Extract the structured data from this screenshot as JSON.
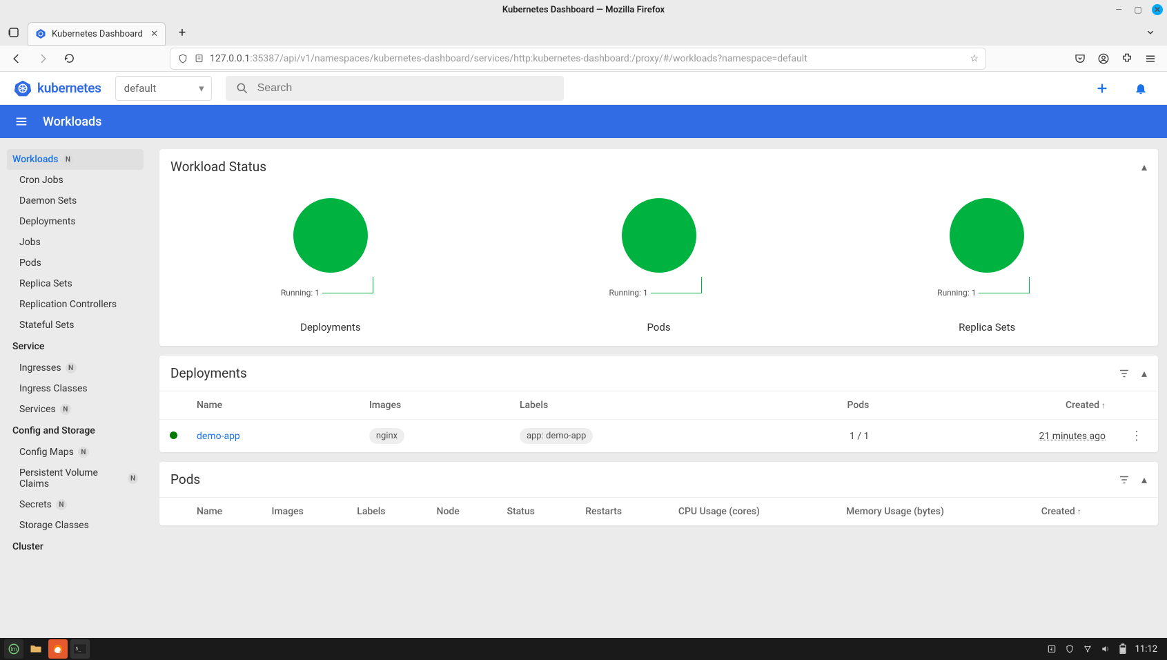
{
  "os": {
    "title": "Kubernetes Dashboard — Mozilla Firefox",
    "clock": "11:12"
  },
  "browser": {
    "tab_title": "Kubernetes Dashboard",
    "url_host": "127.0.0.1",
    "url_port": ":35387",
    "url_path": "/api/v1/namespaces/kubernetes-dashboard/services/http:kubernetes-dashboard:/proxy/#/workloads?namespace=default"
  },
  "header": {
    "logo_text": "kubernetes",
    "namespace": "default",
    "search_placeholder": "Search"
  },
  "bluebar": {
    "title": "Workloads"
  },
  "sidebar": {
    "workloads": {
      "label": "Workloads",
      "badge": "N",
      "items": [
        {
          "label": "Cron Jobs"
        },
        {
          "label": "Daemon Sets"
        },
        {
          "label": "Deployments"
        },
        {
          "label": "Jobs"
        },
        {
          "label": "Pods"
        },
        {
          "label": "Replica Sets"
        },
        {
          "label": "Replication Controllers"
        },
        {
          "label": "Stateful Sets"
        }
      ]
    },
    "service": {
      "label": "Service",
      "items": [
        {
          "label": "Ingresses",
          "badge": "N"
        },
        {
          "label": "Ingress Classes"
        },
        {
          "label": "Services",
          "badge": "N"
        }
      ]
    },
    "config": {
      "label": "Config and Storage",
      "items": [
        {
          "label": "Config Maps",
          "badge": "N"
        },
        {
          "label": "Persistent Volume Claims",
          "badge": "N"
        },
        {
          "label": "Secrets",
          "badge": "N"
        },
        {
          "label": "Storage Classes"
        }
      ]
    },
    "cluster": {
      "label": "Cluster"
    }
  },
  "cards": {
    "workload_status": {
      "title": "Workload Status",
      "charts": [
        {
          "title": "Deployments",
          "legend": "Running: 1"
        },
        {
          "title": "Pods",
          "legend": "Running: 1"
        },
        {
          "title": "Replica Sets",
          "legend": "Running: 1"
        }
      ]
    },
    "deployments": {
      "title": "Deployments",
      "headers": {
        "name": "Name",
        "images": "Images",
        "labels": "Labels",
        "pods": "Pods",
        "created": "Created"
      },
      "rows": [
        {
          "name": "demo-app",
          "image": "nginx",
          "label": "app: demo-app",
          "pods": "1 / 1",
          "created": "21 minutes ago"
        }
      ]
    },
    "pods": {
      "title": "Pods",
      "headers": {
        "name": "Name",
        "images": "Images",
        "labels": "Labels",
        "node": "Node",
        "status": "Status",
        "restarts": "Restarts",
        "cpu": "CPU Usage (cores)",
        "mem": "Memory Usage (bytes)",
        "created": "Created"
      }
    }
  },
  "chart_data": [
    {
      "type": "pie",
      "title": "Deployments",
      "slices": [
        {
          "name": "Running",
          "value": 1,
          "color": "#00b341"
        }
      ]
    },
    {
      "type": "pie",
      "title": "Pods",
      "slices": [
        {
          "name": "Running",
          "value": 1,
          "color": "#00b341"
        }
      ]
    },
    {
      "type": "pie",
      "title": "Replica Sets",
      "slices": [
        {
          "name": "Running",
          "value": 1,
          "color": "#00b341"
        }
      ]
    }
  ]
}
